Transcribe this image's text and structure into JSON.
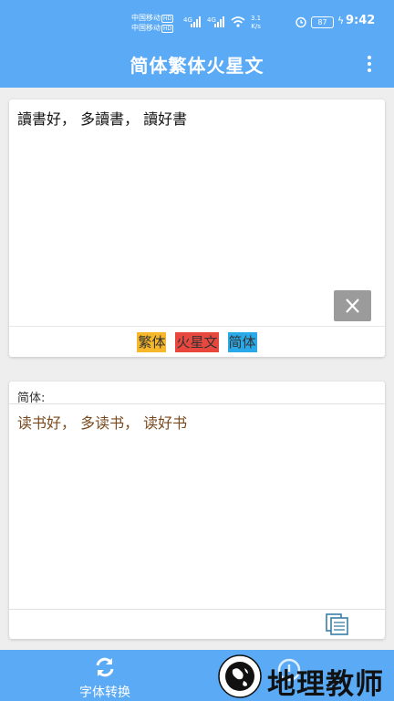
{
  "status": {
    "carrier1": "中国移动",
    "carrier2": "中国移动",
    "hd": "HD",
    "net1": "4G",
    "net2": "4G",
    "speed_value": "3.1",
    "speed_unit": "K/s",
    "battery": "87",
    "time": "9:42"
  },
  "appbar": {
    "title": "简体繁体火星文",
    "menu_icon": "more-vert-icon"
  },
  "input": {
    "text": "讀書好， 多讀書， 讀好書",
    "clear_icon": "close-icon"
  },
  "convert_buttons": {
    "traditional": "繁体",
    "mars": "火星文",
    "simplified": "简体"
  },
  "output": {
    "label": "简体:",
    "text": "读书好， 多读书， 读好书",
    "copy_icon": "copy-icon"
  },
  "navbar": {
    "font_convert_label": "字体转换",
    "font_convert_icon": "swap-icon",
    "info_icon": "info-icon"
  },
  "watermark": {
    "text": "地理教师",
    "emblem_icon": "globe-emblem-icon"
  },
  "colors": {
    "primary": "#5aaaf5",
    "traditional_btn": "#f6b82a",
    "mars_btn": "#e8473d",
    "simplified_btn": "#2aa9e8",
    "output_text": "#7a4a1e",
    "clear_btn": "#9b9b9b"
  }
}
